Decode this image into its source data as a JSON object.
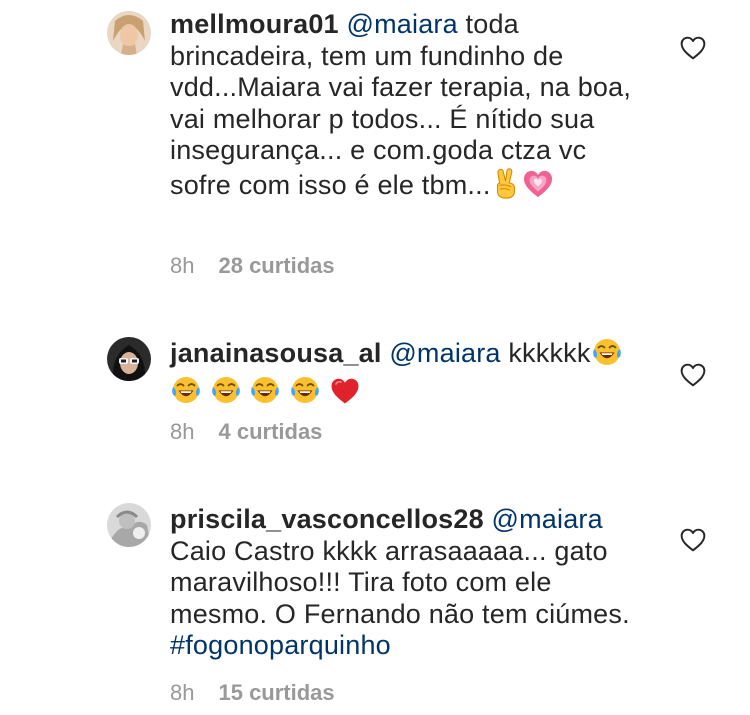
{
  "comments": [
    {
      "username": "mellmoura01",
      "mention": "@maiara",
      "text": "toda brincadeira, tem um fundinho de vdd...Maiara vai fazer terapia, na boa, vai melhorar  p todos... É nítido sua insegurança... e com.goda ctza vc sofre com isso é ele tbm...",
      "emojis": [
        "victory-hand-emoji",
        "growing-heart-emoji"
      ],
      "time": "8h",
      "likes": "28 curtidas"
    },
    {
      "username": "janainasousa_al",
      "mention": "@maiara",
      "text": "kkkkkk",
      "emojis": [
        "tears-of-joy-emoji",
        "tears-of-joy-emoji",
        "tears-of-joy-emoji",
        "tears-of-joy-emoji",
        "tears-of-joy-emoji",
        "red-heart-emoji"
      ],
      "time": "8h",
      "likes": "4 curtidas"
    },
    {
      "username": "priscila_vasconcellos28",
      "mention": "@maiara",
      "text": "Caio Castro kkkk arrasaaaaa... gato maravilhoso!!! Tira foto com ele mesmo. O Fernando não tem ciúmes.",
      "hashtag": "#fogonoparquinho",
      "time": "8h",
      "likes": "15 curtidas"
    }
  ],
  "colors": {
    "text": "#262626",
    "link": "#003569",
    "meta": "#999999"
  }
}
